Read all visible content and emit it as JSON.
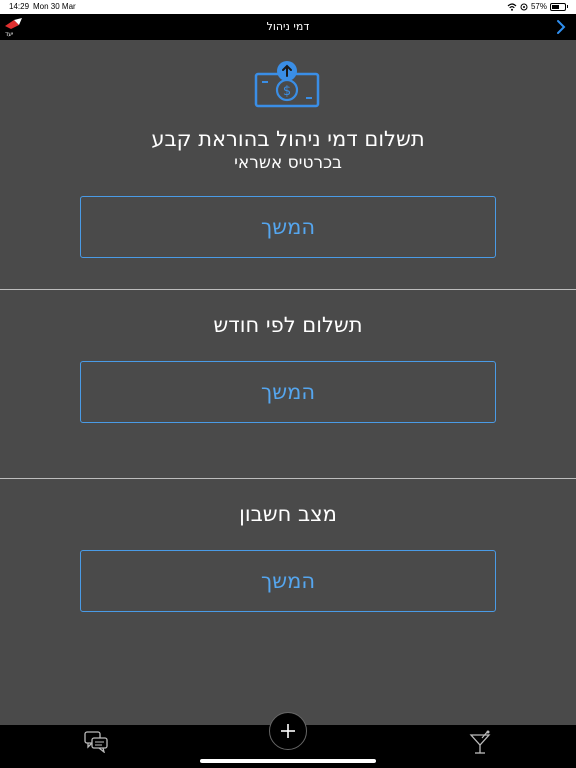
{
  "status_bar": {
    "time": "14:29",
    "date": "Mon 30 Mar",
    "battery": "57%"
  },
  "nav": {
    "title": "דמי ניהול",
    "logo_text": "יעד"
  },
  "sections": [
    {
      "title": "תשלום דמי ניהול בהוראת קבע",
      "subtitle": "בכרטיס אשראי",
      "button_label": "המשך"
    },
    {
      "title": "תשלום לפי חודש",
      "button_label": "המשך"
    },
    {
      "title": "מצב חשבון",
      "button_label": "המשך"
    }
  ],
  "icons": {
    "header": "money-upload-icon",
    "tab_left": "chat-icon",
    "tab_center": "plus-icon",
    "tab_right": "cocktail-icon"
  },
  "colors": {
    "background": "#4a4a4a",
    "accent": "#4a9be6",
    "bars": "#000000"
  }
}
